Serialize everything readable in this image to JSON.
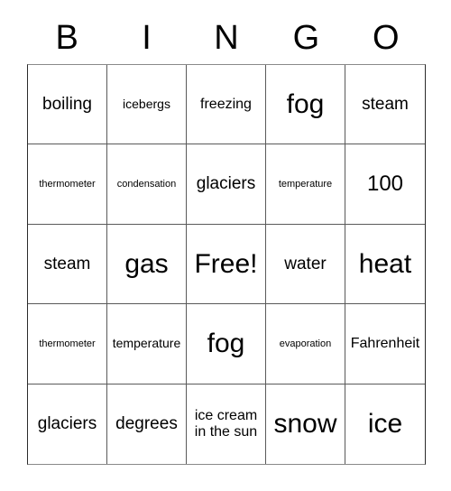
{
  "card": {
    "header_letters": [
      "B",
      "I",
      "N",
      "G",
      "O"
    ],
    "grid": {
      "columns": 5,
      "rows": 5,
      "border_color": "#5a5a5a",
      "outer_border_color": "#2b2b2b",
      "background": "#ffffff",
      "text_color": "#000000"
    },
    "cells": [
      {
        "text": "boiling",
        "size": "lg"
      },
      {
        "text": "icebergs",
        "size": "sm"
      },
      {
        "text": "freezing",
        "size": "md"
      },
      {
        "text": "fog",
        "size": "xxl"
      },
      {
        "text": "steam",
        "size": "lg"
      },
      {
        "text": "thermometer",
        "size": "xs"
      },
      {
        "text": "condensation",
        "size": "xs"
      },
      {
        "text": "glaciers",
        "size": "lg"
      },
      {
        "text": "temperature",
        "size": "xs"
      },
      {
        "text": "100",
        "size": "xl"
      },
      {
        "text": "steam",
        "size": "lg"
      },
      {
        "text": "gas",
        "size": "xxl"
      },
      {
        "text": "Free!",
        "size": "xxl"
      },
      {
        "text": "water",
        "size": "lg"
      },
      {
        "text": "heat",
        "size": "xxl"
      },
      {
        "text": "thermometer",
        "size": "xs"
      },
      {
        "text": "temperature",
        "size": "sm"
      },
      {
        "text": "fog",
        "size": "xxl"
      },
      {
        "text": "evaporation",
        "size": "xs"
      },
      {
        "text": "Fahrenheit",
        "size": "md"
      },
      {
        "text": "glaciers",
        "size": "lg"
      },
      {
        "text": "degrees",
        "size": "lg"
      },
      {
        "text": "ice cream in the sun",
        "size": "md"
      },
      {
        "text": "snow",
        "size": "xxl"
      },
      {
        "text": "ice",
        "size": "xxl"
      }
    ],
    "free_space_index": 12
  }
}
